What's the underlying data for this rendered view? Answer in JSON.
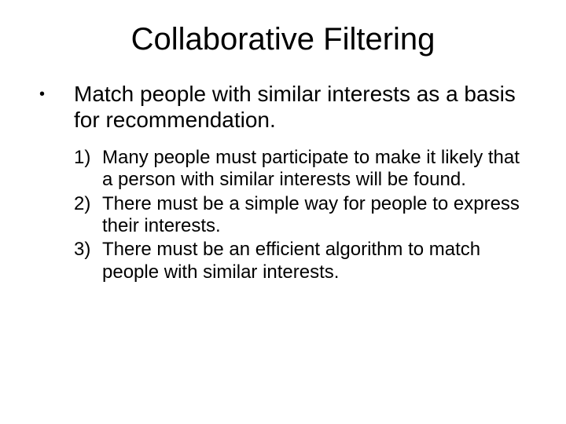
{
  "title": "Collaborative Filtering",
  "bullet": {
    "text": "Match people with similar interests as a basis for recommendation."
  },
  "sublist": [
    {
      "num": "1)",
      "text": "Many people must participate to make it likely that a person with similar interests will be found."
    },
    {
      "num": "2)",
      "text": "There must be a simple way for people to express their interests."
    },
    {
      "num": "3)",
      "text": "There must be an efficient algorithm to match people with similar interests."
    }
  ]
}
